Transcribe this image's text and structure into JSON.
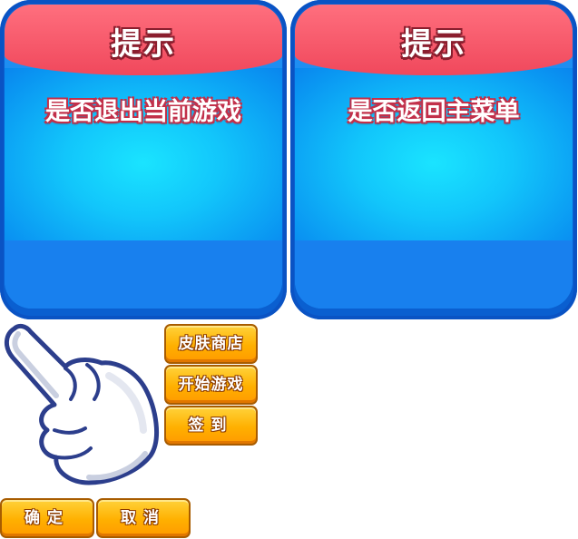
{
  "dialog_exit": {
    "title": "提示",
    "message": "是否退出当前游戏"
  },
  "dialog_menu": {
    "title": "提示",
    "message": "是否返回主菜单"
  },
  "menu_buttons": {
    "skin_shop": "皮肤商店",
    "start_game": "开始游戏",
    "sign_in": "签到"
  },
  "confirm_buttons": {
    "ok": "确定",
    "cancel": "取消"
  },
  "icons": {
    "pointer": "pointing-hand-icon"
  },
  "colors": {
    "header_red": "#f0485c",
    "panel_blue": "#1e8ef2",
    "button_orange": "#ffb000"
  }
}
